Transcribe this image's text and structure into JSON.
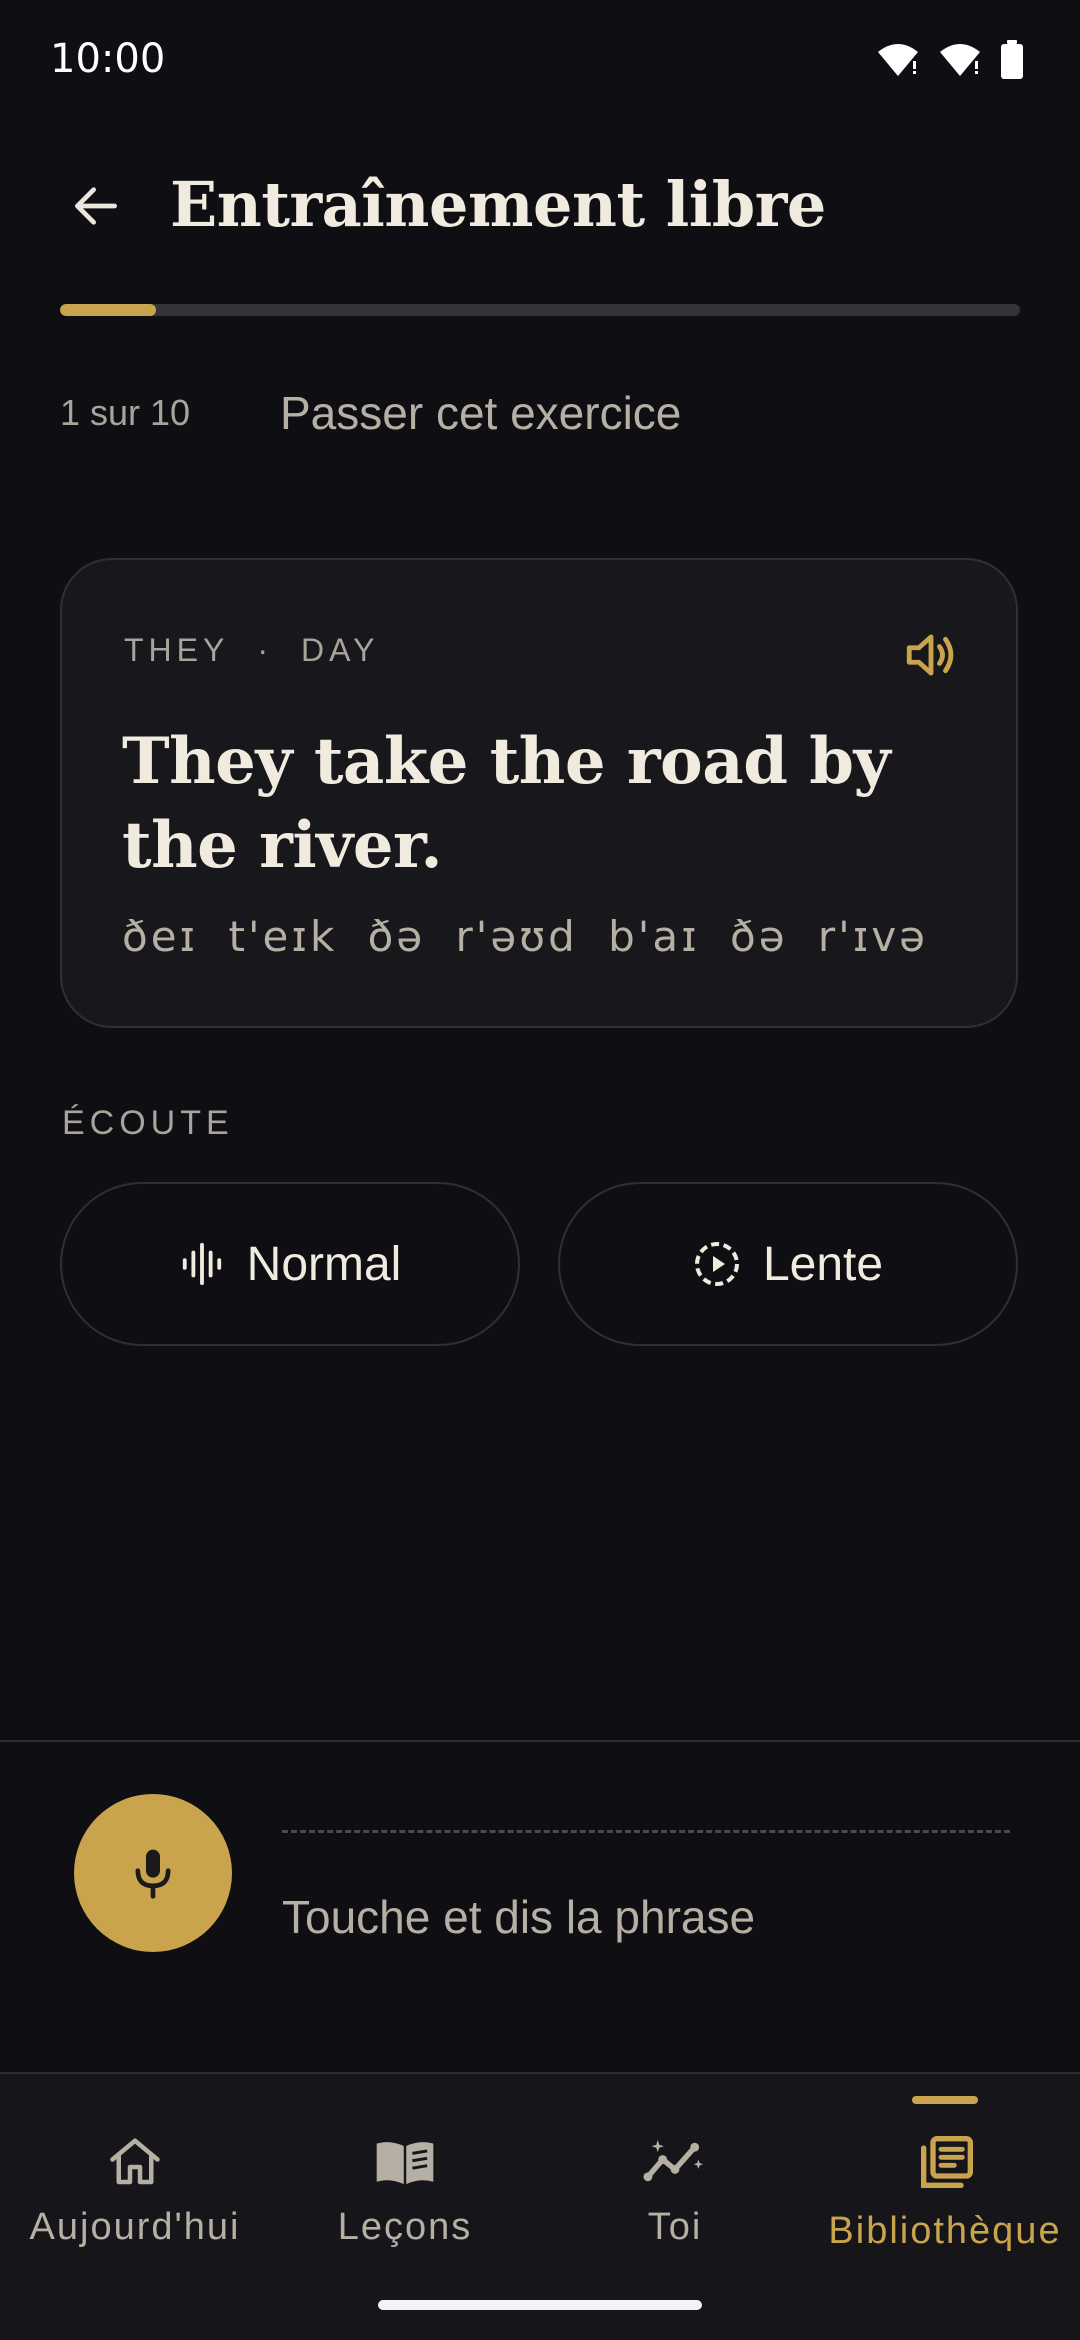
{
  "status_bar": {
    "time": "10:00"
  },
  "header": {
    "title": "Entraînement libre"
  },
  "progress": {
    "fraction": 0.1,
    "counter": "1 sur 10",
    "skip_label": "Passer cet exercice"
  },
  "card": {
    "tags": [
      "THEY",
      "·",
      "DAY"
    ],
    "sentence": "They take the road by the river.",
    "phonetic": "ðeɪ t'eɪk ðə r'əʊd b'aɪ ðə r'ɪvə"
  },
  "listening": {
    "section_label": "ÉCOUTE",
    "normal_label": "Normal",
    "slow_label": "Lente"
  },
  "record": {
    "hint": "Touche et dis la phrase"
  },
  "nav": {
    "items": [
      {
        "label": "Aujourd'hui",
        "icon": "home-icon"
      },
      {
        "label": "Leçons",
        "icon": "book-icon"
      },
      {
        "label": "Toi",
        "icon": "stats-icon"
      },
      {
        "label": "Bibliothèque",
        "icon": "library-icon"
      }
    ],
    "active_index": 3
  },
  "colors": {
    "accent": "#c9a44c",
    "background": "#0f0f13",
    "card": "#18181c",
    "text": "#f1ebdf",
    "muted": "#a9a49b"
  }
}
